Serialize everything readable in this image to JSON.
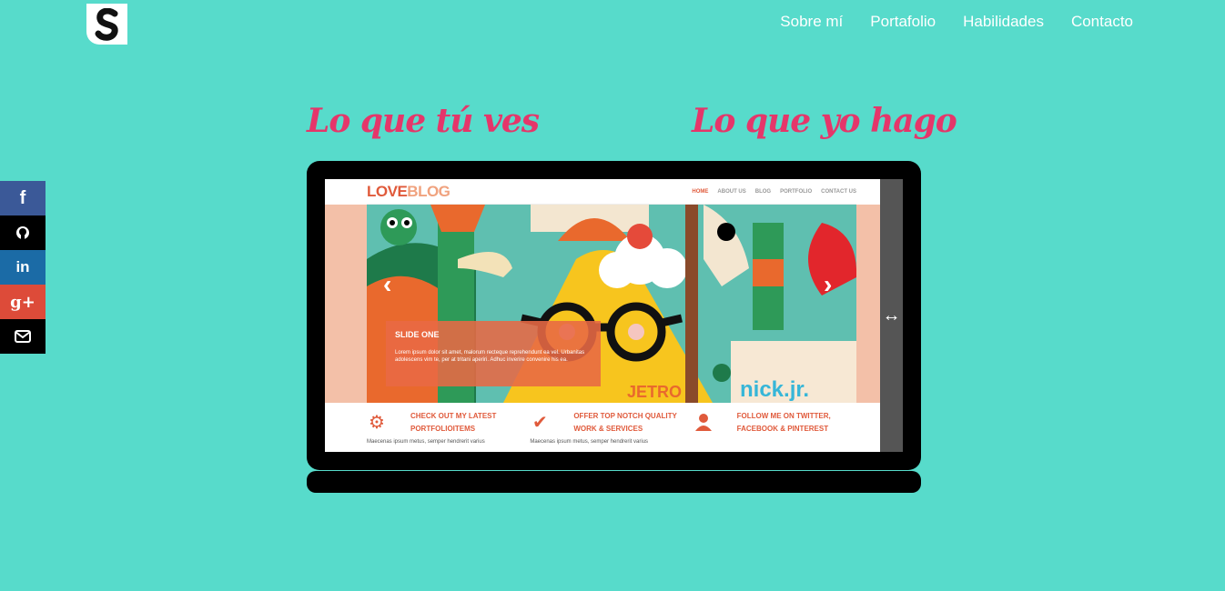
{
  "nav": {
    "items": [
      "Sobre mí",
      "Portafolio",
      "Habilidades",
      "Contacto"
    ]
  },
  "social": [
    {
      "name": "facebook",
      "glyph": "f",
      "color": "#3b5998"
    },
    {
      "name": "github",
      "glyph": "",
      "color": "#000000"
    },
    {
      "name": "linkedin",
      "glyph": "in",
      "color": "#1b6ba6"
    },
    {
      "name": "google-plus",
      "glyph": "g+",
      "color": "#dd4b39"
    },
    {
      "name": "email",
      "glyph": "",
      "color": "#000000"
    }
  ],
  "headings": {
    "left": "Lo que tú ves",
    "right": "Lo que yo hago"
  },
  "handle": {
    "glyph": "↔"
  },
  "preview": {
    "brand_part1": "LOVE",
    "brand_part2": "BLOG",
    "nav": [
      "HOME",
      "ABOUT US",
      "BLOG",
      "PORTFOLIO",
      "CONTACT US"
    ],
    "slide_title": "SLIDE ONE",
    "slide_text": "Lorem ipsum dolor sit amet, malorum recteque reprehendunt ea vel. Urbanitas adolescens vim te, per at tritani aperiri. Adhuc inverire convenire his ea.",
    "art_text_1": "JETRO",
    "art_text_2": "nick.jr.",
    "features": [
      {
        "title": "Check out my latest portfolioitems",
        "text": "Maecenas ipsum metus, semper hendrerit varius"
      },
      {
        "title": "Offer top notch quality work & services",
        "text": "Maecenas ipsum metus, semper hendrerit varius"
      },
      {
        "title": "Follow me on Twitter, Facebook & Pinterest",
        "text": ""
      }
    ]
  },
  "colors": {
    "background": "#57dbcb",
    "accent": "#e5366a",
    "brand": "#e05a3b"
  }
}
